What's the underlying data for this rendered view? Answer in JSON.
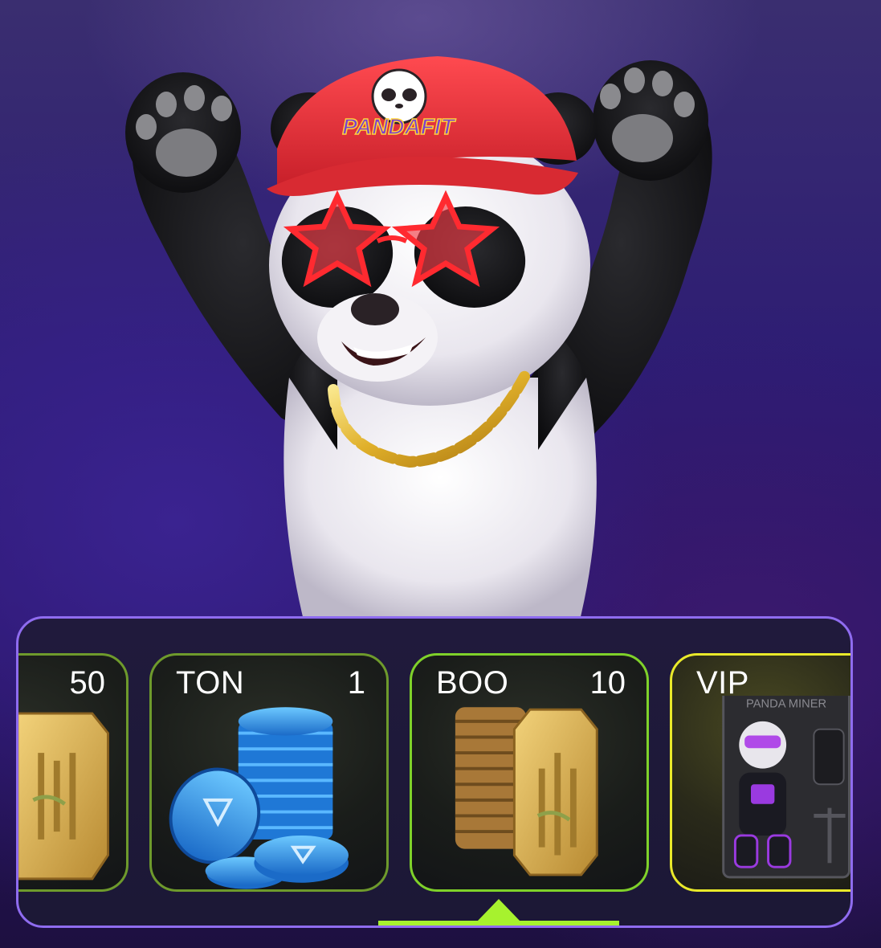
{
  "hero": {
    "character": "panda-mascot",
    "cap_logo_text": "PANDAFIT"
  },
  "carousel": {
    "cards": [
      {
        "name": "",
        "amount": "50",
        "art": "bamboo-tile-icon",
        "state": "partial-left"
      },
      {
        "name": "TON",
        "amount": "1",
        "art": "ton-coins-icon",
        "state": "normal"
      },
      {
        "name": "BOO",
        "amount": "10",
        "art": "bamboo-tile-stack-icon",
        "state": "selected"
      },
      {
        "name": "VIP",
        "amount": "",
        "art": "panda-miner-box-icon",
        "art_label": "PANDA MINER",
        "state": "partial-right"
      }
    ],
    "selected_index": 2
  },
  "colors": {
    "accent_green": "#a7f22e",
    "card_border": "#7fd12a",
    "vip_border": "#e9e92a",
    "panel_border": "#8f6cf0",
    "cap_red": "#e8323c"
  }
}
